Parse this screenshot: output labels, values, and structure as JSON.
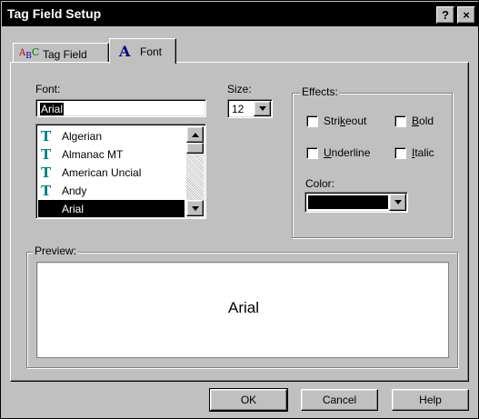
{
  "window": {
    "title": "Tag Field Setup"
  },
  "titlebar_buttons": {
    "help": "?",
    "close": "×"
  },
  "tabs": [
    {
      "label": "Tag Field",
      "icon": "abc-icon",
      "active": false
    },
    {
      "label": "Font",
      "icon": "font-a-icon",
      "active": true
    }
  ],
  "font": {
    "label": "Font:",
    "value": "Arial",
    "list": [
      {
        "name": "Algerian",
        "icon": "truetype-icon",
        "selected": false
      },
      {
        "name": "Almanac MT",
        "icon": "truetype-icon",
        "selected": false
      },
      {
        "name": "American Uncial",
        "icon": "truetype-icon",
        "selected": false
      },
      {
        "name": "Andy",
        "icon": "truetype-icon",
        "selected": false
      },
      {
        "name": "Arial",
        "icon": "truetype-icon",
        "selected": true
      }
    ]
  },
  "size": {
    "label": "Size:",
    "value": "12"
  },
  "effects": {
    "title": "Effects:",
    "strikeout": {
      "pre": "Stri",
      "key": "k",
      "post": "eout",
      "checked": false
    },
    "bold": {
      "pre": "",
      "key": "B",
      "post": "old",
      "checked": false
    },
    "underline": {
      "pre": "",
      "key": "U",
      "post": "nderline",
      "checked": false
    },
    "italic": {
      "pre": "",
      "key": "I",
      "post": "talic",
      "checked": false
    },
    "color": {
      "label": "Color:",
      "value": "#000000"
    }
  },
  "preview": {
    "title": "Preview:",
    "text": "Arial"
  },
  "buttons": {
    "ok": "OK",
    "cancel": "Cancel",
    "help": "Help"
  },
  "colors": {
    "titlebar": "#000000",
    "face": "#c0c0c0",
    "selection": "#000000"
  }
}
